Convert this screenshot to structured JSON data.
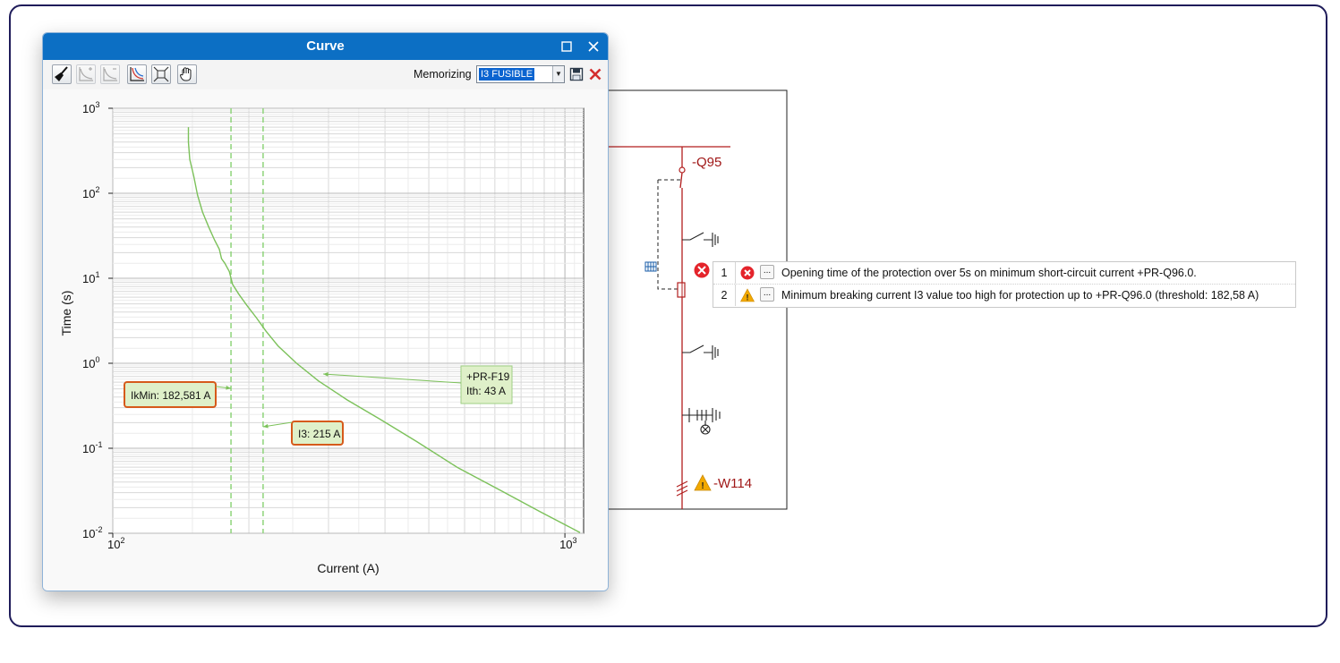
{
  "window": {
    "title": "Curve",
    "memorizing_label": "Memorizing",
    "memorizing_value": "I3 FUSIBLE"
  },
  "chart_data": {
    "type": "line",
    "xlabel": "Current (A)",
    "ylabel": "Time (s)",
    "x_scale": "log",
    "y_scale": "log",
    "xlim": [
      100,
      1100
    ],
    "ylim": [
      0.01,
      1000
    ],
    "x_ticks": [
      {
        "base": "10",
        "exp": "2"
      },
      {
        "base": "10",
        "exp": "3"
      }
    ],
    "y_ticks": [
      {
        "base": "10",
        "exp": "3"
      },
      {
        "base": "10",
        "exp": "2"
      },
      {
        "base": "10",
        "exp": "1"
      },
      {
        "base": "10",
        "exp": "0"
      },
      {
        "base": "10",
        "exp": "-1"
      },
      {
        "base": "10",
        "exp": "-2"
      }
    ],
    "grid": true,
    "series": [
      {
        "name": "+PR-F19",
        "color": "#7cc15a",
        "points": [
          [
            147,
            600
          ],
          [
            147,
            400
          ],
          [
            148,
            250
          ],
          [
            151,
            160
          ],
          [
            154,
            95
          ],
          [
            158,
            60
          ],
          [
            163,
            40
          ],
          [
            168,
            28
          ],
          [
            172,
            22
          ],
          [
            174,
            17
          ],
          [
            177,
            15
          ],
          [
            181,
            12
          ],
          [
            184,
            8.5
          ],
          [
            190,
            6.5
          ],
          [
            198,
            4.8
          ],
          [
            208,
            3.4
          ],
          [
            218,
            2.4
          ],
          [
            232,
            1.6
          ],
          [
            255,
            1.0
          ],
          [
            285,
            0.62
          ],
          [
            330,
            0.37
          ],
          [
            390,
            0.22
          ],
          [
            470,
            0.12
          ],
          [
            580,
            0.059
          ],
          [
            720,
            0.032
          ],
          [
            880,
            0.018
          ],
          [
            1080,
            0.0102
          ]
        ]
      }
    ],
    "vlines": [
      {
        "name": "IkMin",
        "x": 182.581,
        "color": "#8ed47a"
      },
      {
        "name": "I3",
        "x": 215,
        "color": "#8ed47a"
      }
    ],
    "annotations": [
      {
        "id": "ikmin",
        "text": "IkMin: 182,581 A",
        "style": "orange"
      },
      {
        "id": "i3",
        "text": "I3: 215 A",
        "style": "orange"
      },
      {
        "id": "prf19_name",
        "text": "+PR-F19",
        "style": "green"
      },
      {
        "id": "prf19_ith",
        "text": "Ith: 43 A",
        "style": "green"
      }
    ]
  },
  "schematic": {
    "breaker_label": "-Q95",
    "cable_label": "-W114",
    "wire_color": "#b21e1e"
  },
  "error_list": {
    "rows": [
      {
        "num": "1",
        "severity": "error",
        "button": "...",
        "message": "Opening time of the protection over 5s on minimum short-circuit current +PR-Q96.0."
      },
      {
        "num": "2",
        "severity": "warning",
        "button": "...",
        "message": "Minimum breaking current I3 value too high for protection up to +PR-Q96.0 (threshold: 182,58 A)"
      }
    ]
  }
}
